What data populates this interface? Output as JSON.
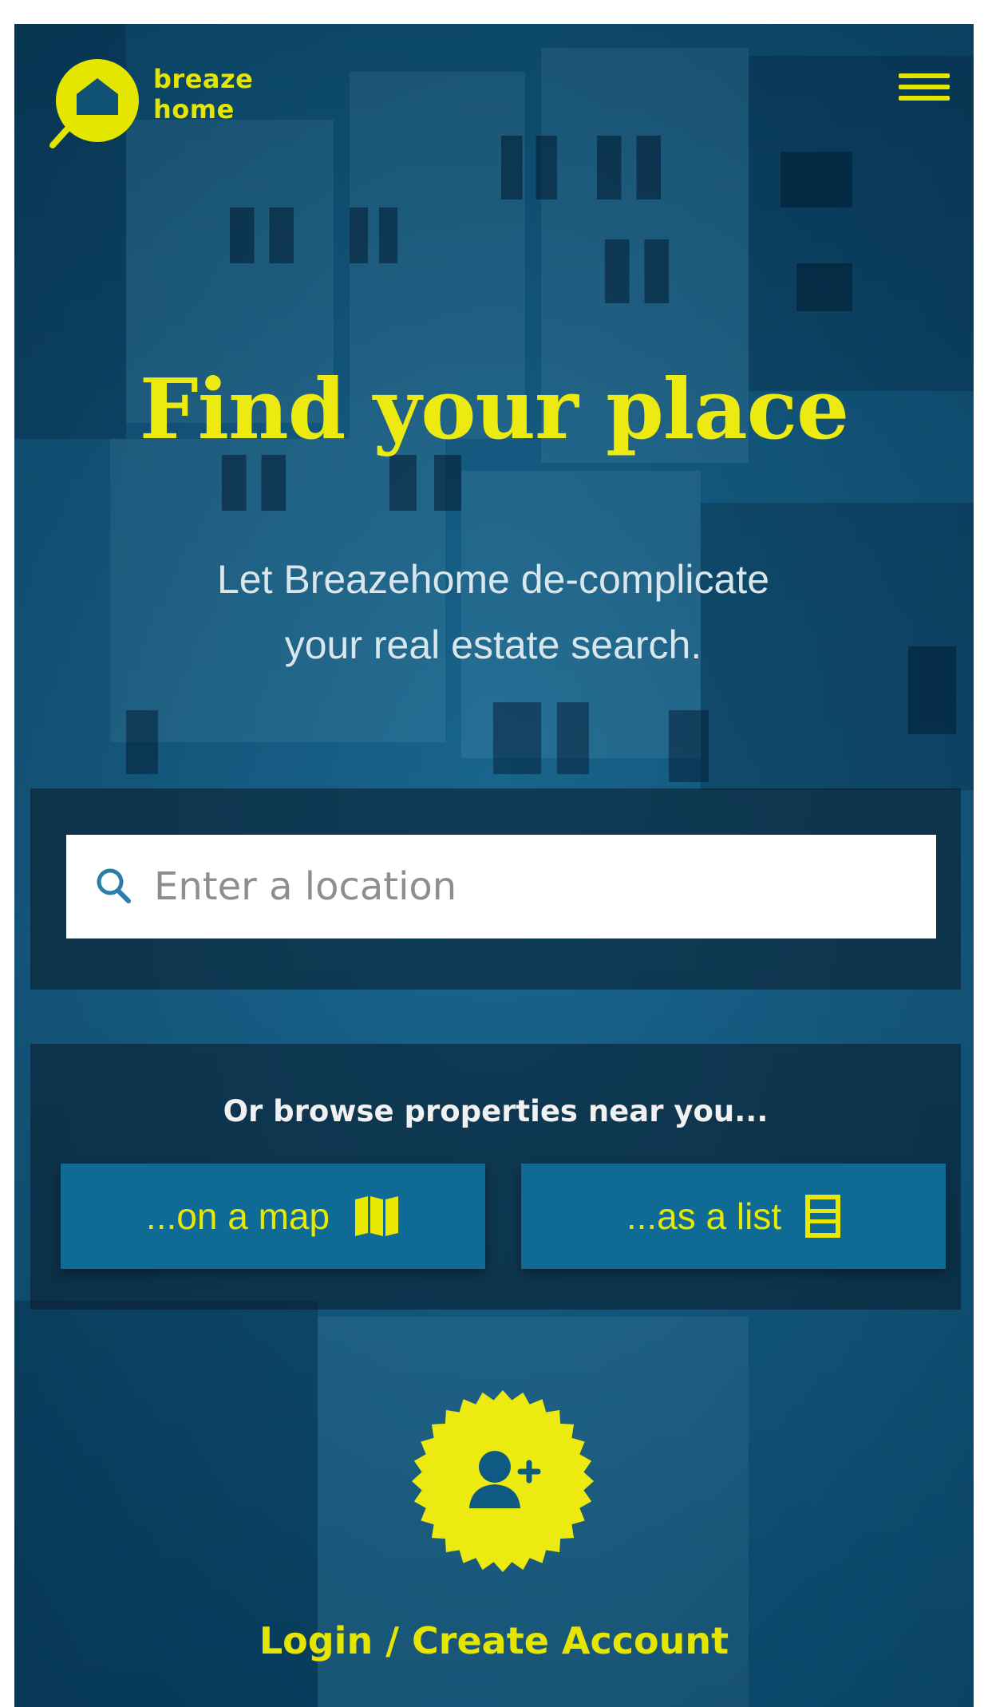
{
  "brand": {
    "logo_line1": "breaze",
    "logo_line2": "home",
    "logo_icon": "house-magnifier-icon",
    "accent_color": "#e5e600",
    "primary_color": "#0f6a95"
  },
  "header": {
    "menu_icon": "hamburger-menu-icon"
  },
  "hero": {
    "title": "Find your place",
    "subtitle_line1": "Let Breazehome de-complicate",
    "subtitle_line2": "your real estate search."
  },
  "search": {
    "icon": "search-icon",
    "value": "",
    "placeholder": "Enter a location"
  },
  "browse": {
    "label": "Or browse properties near you...",
    "map_button_label": "...on a map",
    "map_icon": "map-icon",
    "list_button_label": "...as a list",
    "list_icon": "list-icon"
  },
  "account": {
    "badge_icon": "add-user-icon",
    "login_label": "Login / Create Account"
  }
}
